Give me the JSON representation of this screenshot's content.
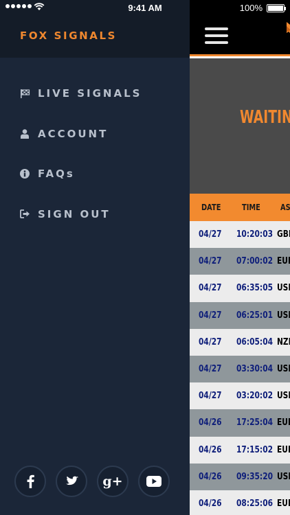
{
  "status_bar": {
    "time": "9:41 AM",
    "battery": "100%"
  },
  "sidebar": {
    "brand": "FOX SIGNALS",
    "items": [
      {
        "label": "LIVE SIGNALS",
        "icon": "flag-icon"
      },
      {
        "label": "ACCOUNT",
        "icon": "user-icon"
      },
      {
        "label": "FAQs",
        "icon": "info-icon"
      },
      {
        "label": "SIGN OUT",
        "icon": "sign-out-icon"
      }
    ],
    "social": [
      "facebook-icon",
      "twitter-icon",
      "google-plus-icon",
      "youtube-icon"
    ],
    "google_plus_glyph": "g+"
  },
  "main": {
    "waiting": "WAITING",
    "columns": [
      "DATE",
      "TIME",
      "ASSET"
    ],
    "rows": [
      {
        "date": "04/27",
        "time": "10:20:03",
        "asset": "GBPAUD"
      },
      {
        "date": "04/27",
        "time": "07:00:02",
        "asset": "EURJPY"
      },
      {
        "date": "04/27",
        "time": "06:35:05",
        "asset": "USDCAD"
      },
      {
        "date": "04/27",
        "time": "06:25:01",
        "asset": "USDJPY"
      },
      {
        "date": "04/27",
        "time": "06:05:04",
        "asset": "NZDUSD"
      },
      {
        "date": "04/27",
        "time": "03:30:04",
        "asset": "USDCHF"
      },
      {
        "date": "04/27",
        "time": "03:20:02",
        "asset": "USDJPY"
      },
      {
        "date": "04/26",
        "time": "17:25:04",
        "asset": "EURUSD"
      },
      {
        "date": "04/26",
        "time": "17:15:02",
        "asset": "EURJPY"
      },
      {
        "date": "04/26",
        "time": "09:35:20",
        "asset": "USDCAD"
      },
      {
        "date": "04/26",
        "time": "08:25:06",
        "asset": "EURUSD"
      }
    ]
  },
  "colors": {
    "accent": "#f0882f",
    "sidebar": "#1b2638",
    "table_text": "#0f1f7a"
  }
}
